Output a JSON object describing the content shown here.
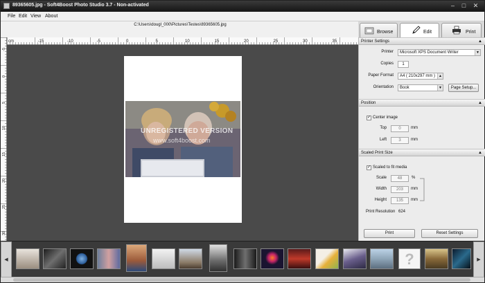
{
  "window": {
    "title": "89365605.jpg  -  Soft4Boost Photo Studio 3.7 - Non-activated"
  },
  "menu": [
    "File",
    "Edit",
    "View",
    "About"
  ],
  "file_path": "C:\\Users\\dougl_000\\Pictures\\Testes\\89365605.jpg",
  "tabs": [
    {
      "label": "Browse",
      "icon": "browse-icon",
      "active": false
    },
    {
      "label": "Edit",
      "icon": "pencil-icon",
      "active": true
    },
    {
      "label": "Print",
      "icon": "printer-icon",
      "active": false
    }
  ],
  "ruler": {
    "h_labels": [
      "cm",
      "-15",
      "-10",
      "-5",
      "0",
      "5",
      "10",
      "15",
      "20",
      "25",
      "30",
      "35"
    ],
    "v_labels": [
      "-5",
      "0",
      "5",
      "10",
      "15",
      "20",
      "25",
      "30"
    ]
  },
  "watermark": {
    "line1": "UNREGISTERED VERSION",
    "line2": "www.soft4boost.com"
  },
  "printer_settings": {
    "header": "Printer Settings",
    "printer_label": "Printer",
    "printer_value": "Microsoft XPS Document Writer",
    "copies_label": "Copies",
    "copies_value": "1",
    "paper_label": "Paper Format",
    "paper_value": "A4 ( 210x297 mm )",
    "orientation_label": "Orientation",
    "orientation_value": "Book",
    "page_setup": "Page Setup..."
  },
  "position": {
    "header": "Position",
    "center_label": "Center image",
    "center_checked": true,
    "top_label": "Top",
    "top_value": "0",
    "left_label": "Left",
    "left_value": "3",
    "unit": "mm"
  },
  "scaled": {
    "header": "Scaled Print Size",
    "fit_label": "Scaled to fit media",
    "fit_checked": true,
    "scale_label": "Scale",
    "scale_value": "48",
    "scale_unit": "%",
    "width_label": "Width",
    "width_value": "203",
    "height_label": "Height",
    "height_value": "135",
    "unit": "mm",
    "resolution_label": "Print Resolution",
    "resolution_value": "624"
  },
  "buttons": {
    "print": "Print",
    "reset": "Reset Settings"
  },
  "thumb_question": "?"
}
